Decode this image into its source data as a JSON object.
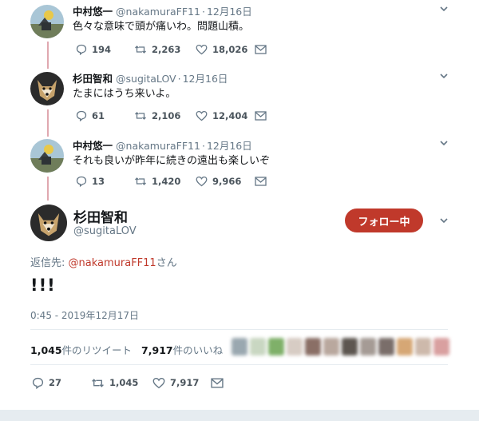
{
  "tweets": [
    {
      "name": "中村悠一",
      "handle": "@nakamuraFF11",
      "date": "12月16日",
      "text": "色々な意味で頭が痛いわ。問題山積。",
      "replies": "194",
      "retweets": "2,263",
      "likes": "18,026",
      "avatar": "landscape-avatar"
    },
    {
      "name": "杉田智和",
      "handle": "@sugitaLOV",
      "date": "12月16日",
      "text": "たまにはうち来いよ。",
      "replies": "61",
      "retweets": "2,106",
      "likes": "12,404",
      "avatar": "dog-avatar"
    },
    {
      "name": "中村悠一",
      "handle": "@nakamuraFF11",
      "date": "12月16日",
      "text": "それも良いが昨年に続きの遠出も楽しいぞ",
      "replies": "13",
      "retweets": "1,420",
      "likes": "9,966",
      "avatar": "landscape-avatar"
    }
  ],
  "main": {
    "name": "杉田智和",
    "handle": "@sugitaLOV",
    "follow_label": "フォロー中",
    "reply_prefix": "返信先: ",
    "reply_mention": "@nakamuraFF11",
    "reply_suffix": "さん",
    "text": "!!!",
    "timestamp": "0:45 - 2019年12月17日",
    "retweet_count": "1,045",
    "retweet_label": "件のリツイート",
    "like_count": "7,917",
    "like_label": "件のいいね",
    "replies": "27",
    "retweets": "1,045",
    "likes": "7,917"
  },
  "colors": {
    "accent": "#c0392b",
    "thread_line": "#e0a8b0",
    "muted_text": "#657786"
  }
}
